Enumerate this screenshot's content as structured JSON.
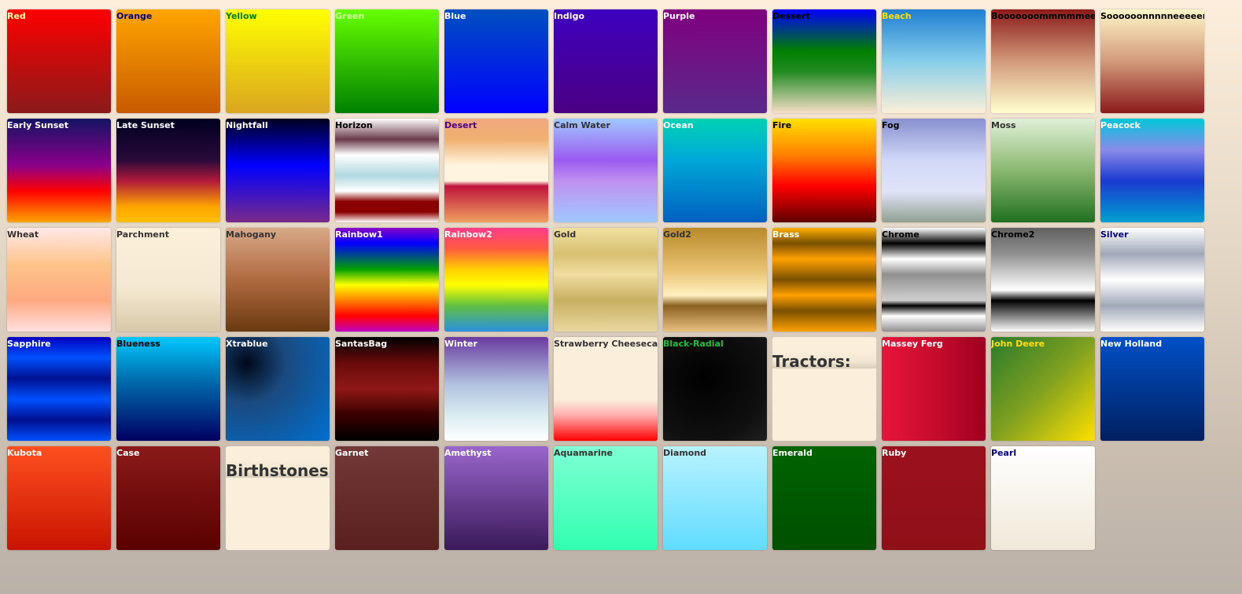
{
  "swatches": [
    {
      "label": "Red",
      "cls": "g-red",
      "label_color": "#ffffaa"
    },
    {
      "label": "Orange",
      "cls": "g-orange",
      "label_color": "#000080"
    },
    {
      "label": "Yellow",
      "cls": "g-yellow",
      "label_color": "#008000"
    },
    {
      "label": "Green",
      "cls": "g-green",
      "label_color": "#d0ffa0"
    },
    {
      "label": "Blue",
      "cls": "g-blue",
      "label_color": "#ffffff"
    },
    {
      "label": "Indigo",
      "cls": "g-indigo",
      "label_color": "#ffffff"
    },
    {
      "label": "Purple",
      "cls": "g-purple",
      "label_color": "#ffffff"
    },
    {
      "label": "Dessert",
      "cls": "g-dessert",
      "label_color": "#000000"
    },
    {
      "label": "Beach",
      "cls": "g-beach",
      "label_color": "#ffe000"
    },
    {
      "label": "Booooooommmmmeeeeerrrr",
      "cls": "g-boom",
      "label_color": "#000000"
    },
    {
      "label": "Soooooonnnnneeeeerrrr",
      "cls": "g-soon",
      "label_color": "#000000"
    },
    {
      "label": "Early Sunset",
      "cls": "g-earlysunset",
      "label_color": "#ffffff"
    },
    {
      "label": "Late Sunset",
      "cls": "g-latesunset",
      "label_color": "#ffffff"
    },
    {
      "label": "Nightfall",
      "cls": "g-nightfall",
      "label_color": "#ffffff"
    },
    {
      "label": "Horizon",
      "cls": "g-horizon",
      "label_color": "#000000"
    },
    {
      "label": "Desert",
      "cls": "g-desert",
      "label_color": "#4b0082"
    },
    {
      "label": "Calm Water",
      "cls": "g-calmwater",
      "label_color": "#333333"
    },
    {
      "label": "Ocean",
      "cls": "g-ocean",
      "label_color": "#ffffff"
    },
    {
      "label": "Fire",
      "cls": "g-fire",
      "label_color": "#000000"
    },
    {
      "label": "Fog",
      "cls": "g-fog",
      "label_color": "#000000"
    },
    {
      "label": "Moss",
      "cls": "g-moss",
      "label_color": "#333333"
    },
    {
      "label": "Peacock",
      "cls": "g-peacock",
      "label_color": "#ffffff"
    },
    {
      "label": "Wheat",
      "cls": "g-wheat",
      "label_color": "#333333"
    },
    {
      "label": "Parchment",
      "cls": "g-parchment",
      "label_color": "#333333"
    },
    {
      "label": "Mahogany",
      "cls": "g-mahogany",
      "label_color": "#333333"
    },
    {
      "label": "Rainbow1",
      "cls": "g-rainbow1",
      "label_color": "#ffffff"
    },
    {
      "label": "Rainbow2",
      "cls": "g-rainbow2",
      "label_color": "#ffffff"
    },
    {
      "label": "Gold",
      "cls": "g-gold",
      "label_color": "#333333"
    },
    {
      "label": "Gold2",
      "cls": "g-gold2",
      "label_color": "#333333"
    },
    {
      "label": "Brass",
      "cls": "g-brass",
      "label_color": "#ffffff"
    },
    {
      "label": "Chrome",
      "cls": "g-chrome",
      "label_color": "#000000"
    },
    {
      "label": "Chrome2",
      "cls": "g-chrome2",
      "label_color": "#000000"
    },
    {
      "label": "Silver",
      "cls": "g-silver",
      "label_color": "#000080"
    },
    {
      "label": "Sapphire",
      "cls": "g-sapphire",
      "label_color": "#ffffff"
    },
    {
      "label": "Blueness",
      "cls": "g-blueness",
      "label_color": "#000000"
    },
    {
      "label": "Xtrablue",
      "cls": "g-xtrablue",
      "label_color": "#ffffff"
    },
    {
      "label": "SantasBag",
      "cls": "g-santasbag",
      "label_color": "#ffffff"
    },
    {
      "label": "Winter",
      "cls": "g-winter",
      "label_color": "#ffffff"
    },
    {
      "label": "Strawberry Cheesecake",
      "cls": "g-strawberry",
      "label_color": "#333333"
    },
    {
      "label": "Black-Radial",
      "cls": "g-blackradial",
      "label_color": "#20c040"
    },
    {
      "heading": "Tractors:"
    },
    {
      "label": "Massey Ferg",
      "cls": "g-massey",
      "label_color": "#ffffff"
    },
    {
      "label": "John Deere",
      "cls": "g-johndeere",
      "label_color": "#ffe000"
    },
    {
      "label": "New Holland",
      "cls": "g-newholland",
      "label_color": "#ffffff"
    },
    {
      "label": "Kubota",
      "cls": "g-kubota",
      "label_color": "#ffffff"
    },
    {
      "label": "Case",
      "cls": "g-case",
      "label_color": "#ffffff"
    },
    {
      "heading": "Birthstones:"
    },
    {
      "label": "Garnet",
      "cls": "g-garnet",
      "label_color": "#ffffff"
    },
    {
      "label": "Amethyst",
      "cls": "g-amethyst",
      "label_color": "#ffffff"
    },
    {
      "label": "Aquamarine",
      "cls": "g-aquamarine",
      "label_color": "#333333"
    },
    {
      "label": "Diamond",
      "cls": "g-diamond",
      "label_color": "#333333"
    },
    {
      "label": "Emerald",
      "cls": "g-emerald",
      "label_color": "#ffffff"
    },
    {
      "label": "Ruby",
      "cls": "g-ruby",
      "label_color": "#ffffff"
    },
    {
      "label": "Pearl",
      "cls": "g-pearl",
      "label_color": "#000080"
    }
  ]
}
